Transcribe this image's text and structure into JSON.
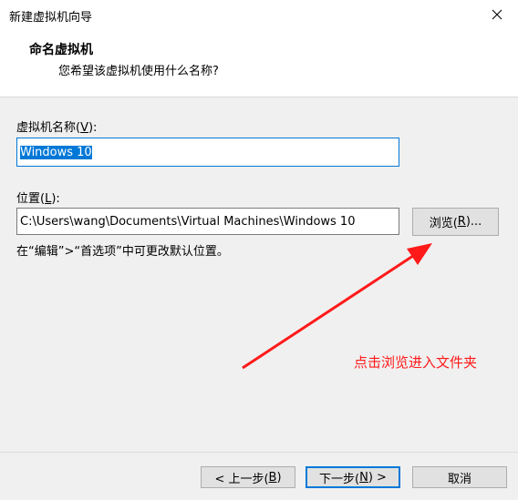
{
  "window": {
    "title": "新建虚拟机向导"
  },
  "header": {
    "title": "命名虚拟机",
    "subtitle": "您希望该虚拟机使用什么名称?"
  },
  "vm_name": {
    "label_prefix": "虚拟机名称(",
    "mnemonic": "V",
    "label_suffix": "):",
    "value": "Windows 10"
  },
  "location": {
    "label_prefix": "位置(",
    "mnemonic": "L",
    "label_suffix": "):",
    "value": "C:\\Users\\wang\\Documents\\Virtual Machines\\Windows 10",
    "browse_prefix": "浏览(",
    "browse_mnemonic": "R",
    "browse_suffix": ")...",
    "hint": "在“编辑”>“首选项”中可更改默认位置。"
  },
  "annotation": {
    "text": "点击浏览进入文件夹",
    "color": "#ff1a1a"
  },
  "buttons": {
    "back_prefix": "< 上一步(",
    "back_mnemonic": "B",
    "back_suffix": ")",
    "next_prefix": "下一步(",
    "next_mnemonic": "N",
    "next_suffix": ") >",
    "cancel": "取消"
  },
  "icons": {
    "close": "close-icon",
    "arrow": "red-arrow-icon"
  }
}
